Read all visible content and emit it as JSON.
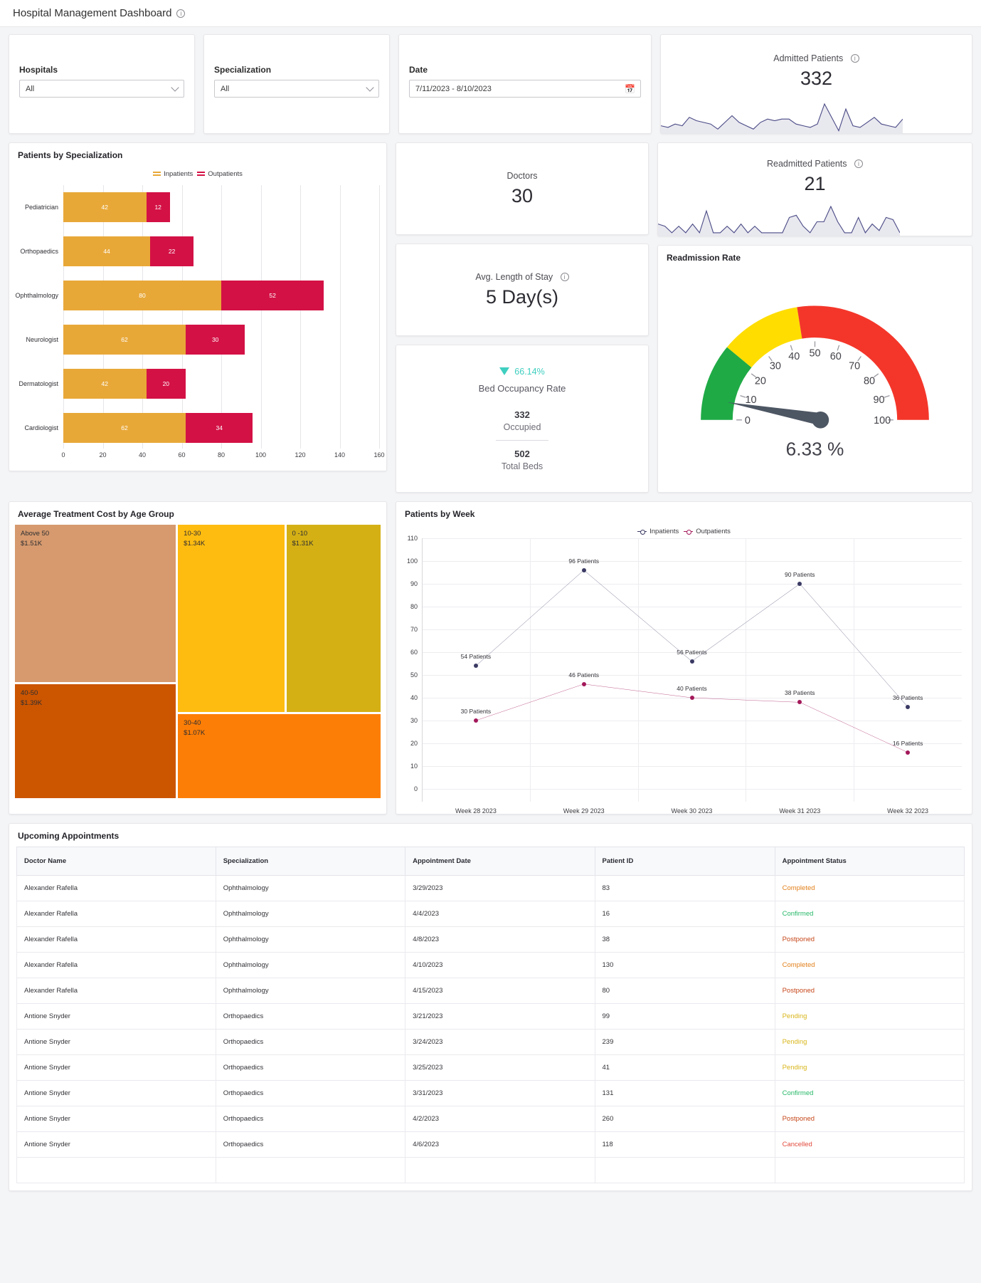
{
  "header": {
    "title": "Hospital Management Dashboard",
    "info_icon": "info-icon"
  },
  "filters": {
    "hospitals": {
      "label": "Hospitals",
      "value": "All"
    },
    "specialization": {
      "label": "Specialization",
      "value": "All"
    },
    "date": {
      "label": "Date",
      "value": "7/11/2023 - 8/10/2023",
      "icon": "calendar-icon"
    }
  },
  "kpis": {
    "admitted": {
      "title": "Admitted Patients",
      "value": "332"
    },
    "readmitted": {
      "title": "Readmitted Patients",
      "value": "21"
    },
    "doctors": {
      "title": "Doctors",
      "value": "30"
    },
    "avg_stay": {
      "title": "Avg. Length of Stay",
      "value": "5 Day(s)"
    }
  },
  "bed_occupancy": {
    "percent": "66.14%",
    "label": "Bed Occupancy Rate",
    "occupied_value": "332",
    "occupied_label": "Occupied",
    "total_value": "502",
    "total_label": "Total Beds",
    "accent": "#3fcfc0"
  },
  "readmission": {
    "title": "Readmission Rate",
    "value_label": "6.33 %",
    "value": 6.33,
    "ticks": [
      "0",
      "10",
      "20",
      "30",
      "40",
      "50",
      "60",
      "70",
      "80",
      "90",
      "100"
    ],
    "bands": [
      {
        "from": 0,
        "to": 22,
        "color": "#1faa46"
      },
      {
        "from": 22,
        "to": 45,
        "color": "#ffdd00"
      },
      {
        "from": 45,
        "to": 100,
        "color": "#f4362a"
      }
    ]
  },
  "panels": {
    "patients_by_specialization": "Patients by Specialization",
    "treatment_cost": "Average Treatment Cost by Age Group",
    "patients_by_week": "Patients by Week",
    "appointments": "Upcoming Appointments"
  },
  "chart_data": [
    {
      "type": "bar",
      "title": "Patients by Specialization",
      "orientation": "horizontal",
      "stacked": true,
      "categories": [
        "Pediatrician",
        "Orthopaedics",
        "Ophthalmology",
        "Neurologist",
        "Dermatologist",
        "Cardiologist"
      ],
      "series": [
        {
          "name": "Inpatients",
          "color": "#e8a838",
          "values": [
            42,
            44,
            80,
            62,
            42,
            62
          ]
        },
        {
          "name": "Outpatients",
          "color": "#d31145",
          "values": [
            12,
            22,
            52,
            30,
            20,
            34
          ]
        }
      ],
      "xlabel": "",
      "ylabel": "",
      "xlim": [
        0,
        160
      ],
      "xticks": [
        "0",
        "20",
        "40",
        "60",
        "80",
        "100",
        "120",
        "140",
        "160"
      ],
      "grid": true,
      "legend_position": "top"
    },
    {
      "type": "heatmap",
      "subtype": "treemap",
      "title": "Average Treatment Cost by Age Group",
      "categories": [
        "Above 50",
        "40-50",
        "10-30",
        "0 -10",
        "30-40"
      ],
      "labels": [
        "$1.51K",
        "$1.39K",
        "$1.34K",
        "$1.31K",
        "$1.07K"
      ],
      "values": [
        1510,
        1390,
        1340,
        1310,
        1070
      ],
      "colors": [
        "#d69a6e",
        "#cc5500",
        "#ffbc10",
        "#d4b015",
        "#fd7e06"
      ]
    },
    {
      "type": "line",
      "title": "Patients by Week",
      "categories": [
        "Week 28 2023",
        "Week 29 2023",
        "Week 30 2023",
        "Week 31 2023",
        "Week 32 2023"
      ],
      "series": [
        {
          "name": "Inpatients",
          "color": "#3a3a64",
          "values": [
            54,
            96,
            56,
            90,
            36
          ],
          "labels": [
            "54 Patients",
            "96 Patients",
            "56 Patients",
            "90 Patients",
            "36 Patients"
          ]
        },
        {
          "name": "Outpatients",
          "color": "#a3185a",
          "values": [
            30,
            46,
            40,
            38,
            16
          ],
          "labels": [
            "30 Patients",
            "46 Patients",
            "40 Patients",
            "38 Patients",
            "16 Patients"
          ]
        }
      ],
      "ylim": [
        0,
        110
      ],
      "yticks": [
        "0",
        "10",
        "20",
        "30",
        "40",
        "50",
        "60",
        "70",
        "80",
        "90",
        "100",
        "110"
      ],
      "xlabel": "",
      "ylabel": "",
      "grid": true,
      "legend_position": "top"
    }
  ],
  "appointments_table": {
    "columns": [
      "Doctor Name",
      "Specialization",
      "Appointment Date",
      "Patient ID",
      "Appointment Status"
    ],
    "rows": [
      [
        "Alexander Rafella",
        "Ophthalmology",
        "3/29/2023",
        "83",
        "Completed"
      ],
      [
        "Alexander Rafella",
        "Ophthalmology",
        "4/4/2023",
        "16",
        "Confirmed"
      ],
      [
        "Alexander Rafella",
        "Ophthalmology",
        "4/8/2023",
        "38",
        "Postponed"
      ],
      [
        "Alexander Rafella",
        "Ophthalmology",
        "4/10/2023",
        "130",
        "Completed"
      ],
      [
        "Alexander Rafella",
        "Ophthalmology",
        "4/15/2023",
        "80",
        "Postponed"
      ],
      [
        "Antione Snyder",
        "Orthopaedics",
        "3/21/2023",
        "99",
        "Pending"
      ],
      [
        "Antione Snyder",
        "Orthopaedics",
        "3/24/2023",
        "239",
        "Pending"
      ],
      [
        "Antione Snyder",
        "Orthopaedics",
        "3/25/2023",
        "41",
        "Pending"
      ],
      [
        "Antione Snyder",
        "Orthopaedics",
        "3/31/2023",
        "131",
        "Confirmed"
      ],
      [
        "Antione Snyder",
        "Orthopaedics",
        "4/2/2023",
        "260",
        "Postponed"
      ],
      [
        "Antione Snyder",
        "Orthopaedics",
        "4/6/2023",
        "118",
        "Cancelled"
      ]
    ]
  },
  "sparklines": {
    "admitted": [
      4,
      3,
      5,
      4,
      9,
      7,
      6,
      5,
      2,
      6,
      10,
      6,
      4,
      2,
      6,
      8,
      7,
      8,
      8,
      5,
      4,
      3,
      5,
      17,
      9,
      1,
      14,
      4,
      3,
      6,
      9,
      5,
      4,
      3,
      8
    ],
    "readmitted": [
      5,
      4,
      1,
      4,
      1,
      5,
      1,
      11,
      1,
      1,
      4,
      1,
      5,
      1,
      4,
      1,
      1,
      1,
      1,
      8,
      9,
      4,
      1,
      6,
      6,
      13,
      6,
      1,
      1,
      8,
      1,
      5,
      2,
      8,
      7,
      1
    ]
  }
}
